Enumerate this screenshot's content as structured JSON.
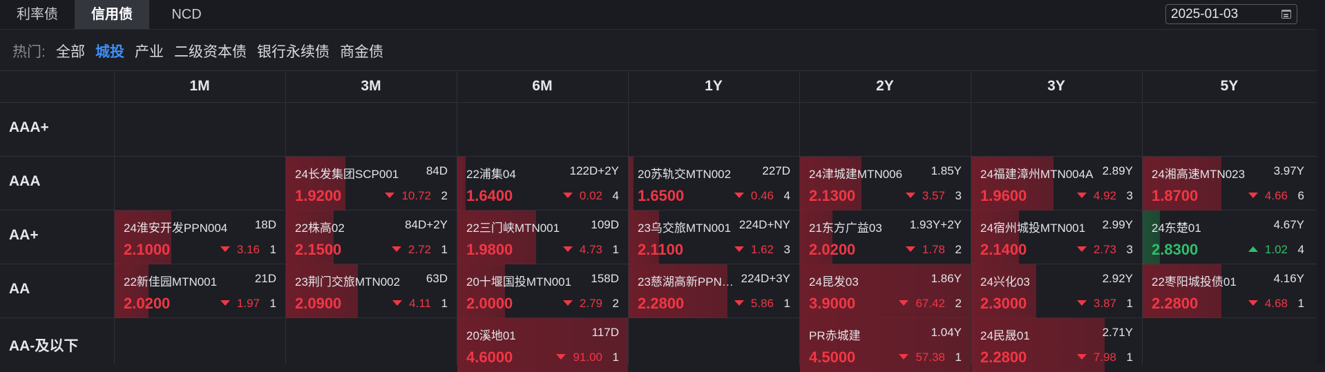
{
  "tabs": [
    {
      "label": "利率债",
      "active": false
    },
    {
      "label": "信用债",
      "active": true
    },
    {
      "label": "NCD",
      "active": false
    }
  ],
  "date": {
    "value": "2025-01-03",
    "icon": "calendar-icon"
  },
  "filters": {
    "hot_label": "热门:",
    "tags": [
      {
        "label": "全部",
        "active": false
      },
      {
        "label": "城投",
        "active": true
      },
      {
        "label": "产业",
        "active": false
      },
      {
        "label": "二级资本债",
        "active": false
      },
      {
        "label": "银行永续债",
        "active": false
      },
      {
        "label": "商金债",
        "active": false
      }
    ]
  },
  "columns": [
    "1M",
    "3M",
    "6M",
    "1Y",
    "2Y",
    "3Y",
    "5Y"
  ],
  "rows": [
    "AAA+",
    "AAA",
    "AA+",
    "AA",
    "AA-及以下"
  ],
  "colors": {
    "up": "#f23645",
    "down": "#2fbf6a",
    "heat_red": "#7a1e2c",
    "heat_green": "#1f5a3a"
  },
  "cells": [
    {
      "row": 1,
      "col": 1,
      "name": "24长发集团SCP001",
      "term": "84D",
      "yield": "1.9200",
      "dir": "down",
      "change": "10.72",
      "count": "2",
      "heat": 0.35
    },
    {
      "row": 1,
      "col": 2,
      "name": "22浦集04",
      "term": "122D+2Y",
      "yield": "1.6400",
      "dir": "down",
      "change": "0.02",
      "count": "4",
      "heat": 0.05
    },
    {
      "row": 1,
      "col": 3,
      "name": "20苏轨交MTN002",
      "term": "227D",
      "yield": "1.6500",
      "dir": "down",
      "change": "0.46",
      "count": "4",
      "heat": 0.03
    },
    {
      "row": 1,
      "col": 4,
      "name": "24津城建MTN006",
      "term": "1.85Y",
      "yield": "2.1300",
      "dir": "down",
      "change": "3.57",
      "count": "3",
      "heat": 0.36
    },
    {
      "row": 1,
      "col": 5,
      "name": "24福建漳州MTN004A",
      "term": "2.89Y",
      "yield": "1.9600",
      "dir": "down",
      "change": "4.92",
      "count": "3",
      "heat": 0.48
    },
    {
      "row": 1,
      "col": 6,
      "name": "24湘高速MTN023",
      "term": "3.97Y",
      "yield": "1.8700",
      "dir": "down",
      "change": "4.66",
      "count": "6",
      "heat": 0.46
    },
    {
      "row": 2,
      "col": 0,
      "name": "24淮安开发PPN004",
      "term": "18D",
      "yield": "2.1000",
      "dir": "down",
      "change": "3.16",
      "count": "1",
      "heat": 0.33
    },
    {
      "row": 2,
      "col": 1,
      "name": "22株高02",
      "term": "84D+2Y",
      "yield": "2.1500",
      "dir": "down",
      "change": "2.72",
      "count": "1",
      "heat": 0.28
    },
    {
      "row": 2,
      "col": 2,
      "name": "22三门峡MTN001",
      "term": "109D",
      "yield": "1.9800",
      "dir": "down",
      "change": "4.73",
      "count": "1",
      "heat": 0.46
    },
    {
      "row": 2,
      "col": 3,
      "name": "23乌交旅MTN001",
      "term": "224D+NY",
      "yield": "2.1100",
      "dir": "down",
      "change": "1.62",
      "count": "3",
      "heat": 0.18
    },
    {
      "row": 2,
      "col": 4,
      "name": "21东方广益03",
      "term": "1.93Y+2Y",
      "yield": "2.0200",
      "dir": "down",
      "change": "1.78",
      "count": "2",
      "heat": 0.19
    },
    {
      "row": 2,
      "col": 5,
      "name": "24宿州城投MTN001",
      "term": "2.99Y",
      "yield": "2.1400",
      "dir": "down",
      "change": "2.73",
      "count": "3",
      "heat": 0.28
    },
    {
      "row": 2,
      "col": 6,
      "name": "24东楚01",
      "term": "4.67Y",
      "yield": "2.8300",
      "dir": "up",
      "change": "1.02",
      "count": "4",
      "heat": 0.1
    },
    {
      "row": 3,
      "col": 0,
      "name": "22新佳园MTN001",
      "term": "21D",
      "yield": "2.0200",
      "dir": "down",
      "change": "1.97",
      "count": "1",
      "heat": 0.2
    },
    {
      "row": 3,
      "col": 1,
      "name": "23荆门交旅MTN002",
      "term": "63D",
      "yield": "2.0900",
      "dir": "down",
      "change": "4.11",
      "count": "1",
      "heat": 0.42
    },
    {
      "row": 3,
      "col": 2,
      "name": "20十堰国投MTN001",
      "term": "158D",
      "yield": "2.0000",
      "dir": "down",
      "change": "2.79",
      "count": "2",
      "heat": 0.28
    },
    {
      "row": 3,
      "col": 3,
      "name": "23慈湖高新PPN…",
      "term": "224D+3Y",
      "yield": "2.2800",
      "dir": "down",
      "change": "5.86",
      "count": "1",
      "heat": 0.58
    },
    {
      "row": 3,
      "col": 4,
      "name": "24昆发03",
      "term": "1.86Y",
      "yield": "3.9000",
      "dir": "down",
      "change": "67.42",
      "count": "2",
      "heat": 1.0
    },
    {
      "row": 3,
      "col": 5,
      "name": "24兴化03",
      "term": "2.92Y",
      "yield": "2.3000",
      "dir": "down",
      "change": "3.87",
      "count": "1",
      "heat": 0.38
    },
    {
      "row": 3,
      "col": 6,
      "name": "22枣阳城投债01",
      "term": "4.16Y",
      "yield": "2.2800",
      "dir": "down",
      "change": "4.68",
      "count": "1",
      "heat": 0.46
    },
    {
      "row": 4,
      "col": 2,
      "name": "20溪地01",
      "term": "117D",
      "yield": "4.6000",
      "dir": "down",
      "change": "91.00",
      "count": "1",
      "heat": 1.0
    },
    {
      "row": 4,
      "col": 4,
      "name": "PR赤城建",
      "term": "1.04Y",
      "yield": "4.5000",
      "dir": "down",
      "change": "57.38",
      "count": "1",
      "heat": 1.0
    },
    {
      "row": 4,
      "col": 5,
      "name": "24民晟01",
      "term": "2.71Y",
      "yield": "2.2800",
      "dir": "down",
      "change": "7.98",
      "count": "1",
      "heat": 0.78
    }
  ]
}
